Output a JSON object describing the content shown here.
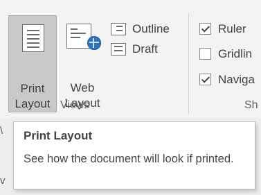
{
  "views_group": {
    "print_layout": {
      "line1": "Print",
      "line2": "Layout",
      "icon": "print-layout-icon"
    },
    "web_layout": {
      "line1": "Web",
      "line2": "Layout",
      "icon": "web-layout-icon"
    },
    "outline": {
      "label": "Outline",
      "icon": "outline-icon"
    },
    "draft": {
      "label": "Draft",
      "icon": "draft-icon"
    },
    "group_label": "Views"
  },
  "show_group": {
    "items": [
      {
        "label": "Ruler",
        "checked": true
      },
      {
        "label": "Gridlin",
        "checked": false
      },
      {
        "label": "Naviga",
        "checked": true
      }
    ],
    "group_label": "Sh"
  },
  "tooltip": {
    "title": "Print Layout",
    "description": "See how the document will look if printed."
  },
  "edge_fragments": [
    "\\",
    "v"
  ]
}
